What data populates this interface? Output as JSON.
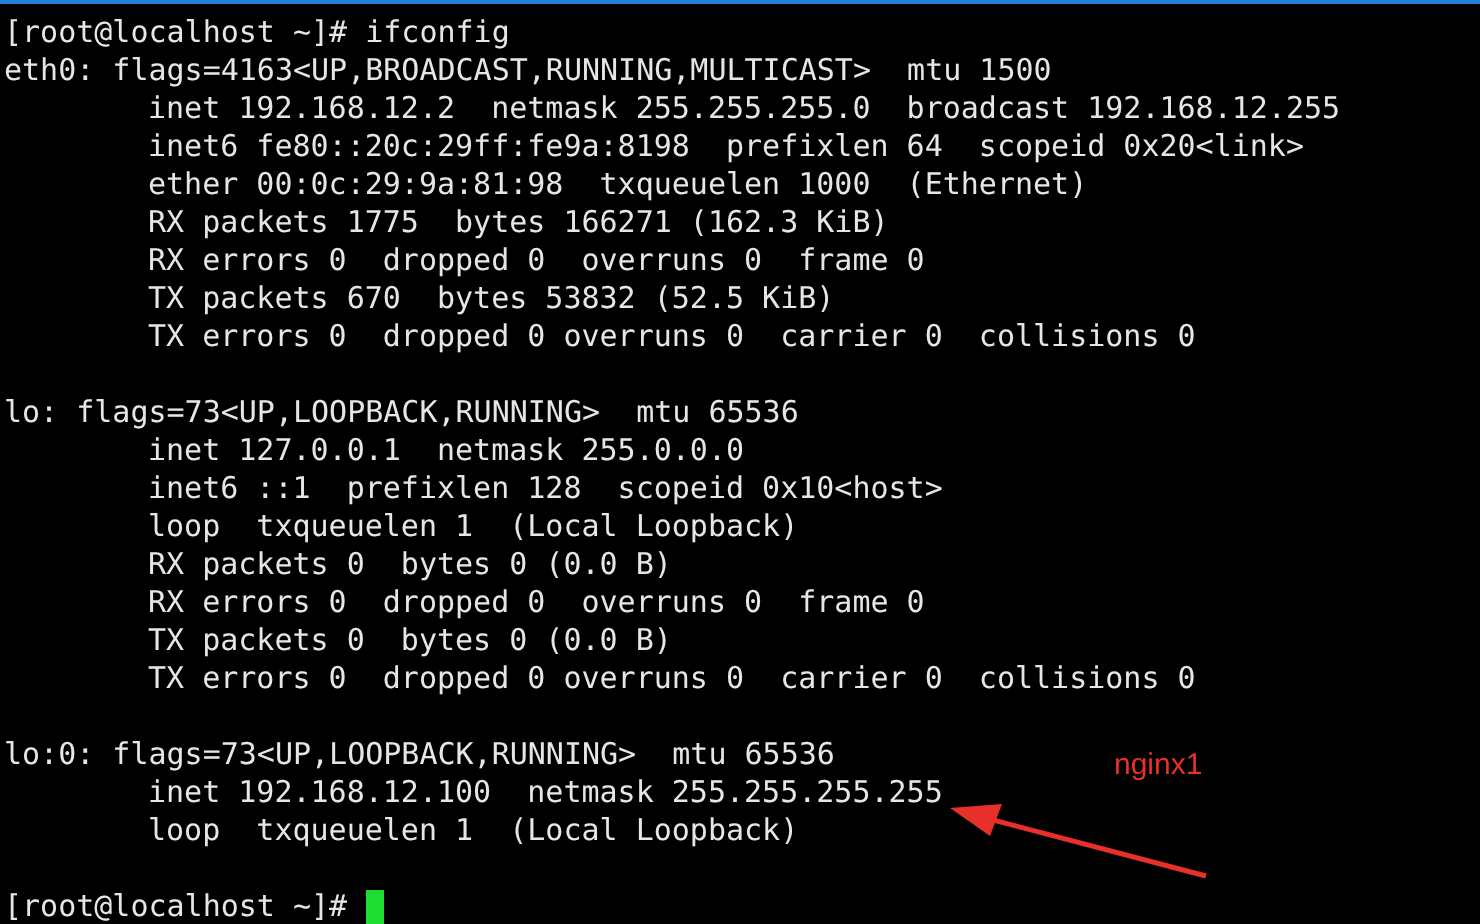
{
  "terminal": {
    "command_line": "[root@localhost ~]# ifconfig",
    "interfaces": [
      {
        "header": "eth0: flags=4163<UP,BROADCAST,RUNNING,MULTICAST>  mtu 1500",
        "details": [
          "inet 192.168.12.2  netmask 255.255.255.0  broadcast 192.168.12.255",
          "inet6 fe80::20c:29ff:fe9a:8198  prefixlen 64  scopeid 0x20<link>",
          "ether 00:0c:29:9a:81:98  txqueuelen 1000  (Ethernet)",
          "RX packets 1775  bytes 166271 (162.3 KiB)",
          "RX errors 0  dropped 0  overruns 0  frame 0",
          "TX packets 670  bytes 53832 (52.5 KiB)",
          "TX errors 0  dropped 0 overruns 0  carrier 0  collisions 0"
        ]
      },
      {
        "header": "lo: flags=73<UP,LOOPBACK,RUNNING>  mtu 65536",
        "details": [
          "inet 127.0.0.1  netmask 255.0.0.0",
          "inet6 ::1  prefixlen 128  scopeid 0x10<host>",
          "loop  txqueuelen 1  (Local Loopback)",
          "RX packets 0  bytes 0 (0.0 B)",
          "RX errors 0  dropped 0  overruns 0  frame 0",
          "TX packets 0  bytes 0 (0.0 B)",
          "TX errors 0  dropped 0 overruns 0  carrier 0  collisions 0"
        ]
      },
      {
        "header": "lo:0: flags=73<UP,LOOPBACK,RUNNING>  mtu 65536",
        "details": [
          "inet 192.168.12.100  netmask 255.255.255.255",
          "loop  txqueuelen 1  (Local Loopback)"
        ]
      }
    ],
    "prompt": "[root@localhost ~]#"
  },
  "annotation": {
    "label": "nginx1"
  }
}
